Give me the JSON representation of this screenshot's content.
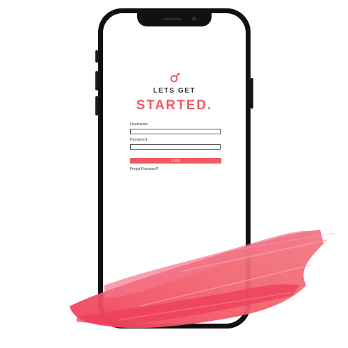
{
  "title": {
    "line1": "LETS GET",
    "line2": "STARTED."
  },
  "form": {
    "username_label": "Username",
    "password_label": "Password",
    "login_label": "Login",
    "forgot_label": "Forgot Password?"
  },
  "colors": {
    "accent": "#f2595f",
    "brush": "#f04a5e",
    "phone_frame": "#111111"
  },
  "icons": {
    "logo": "app-logo-icon"
  }
}
